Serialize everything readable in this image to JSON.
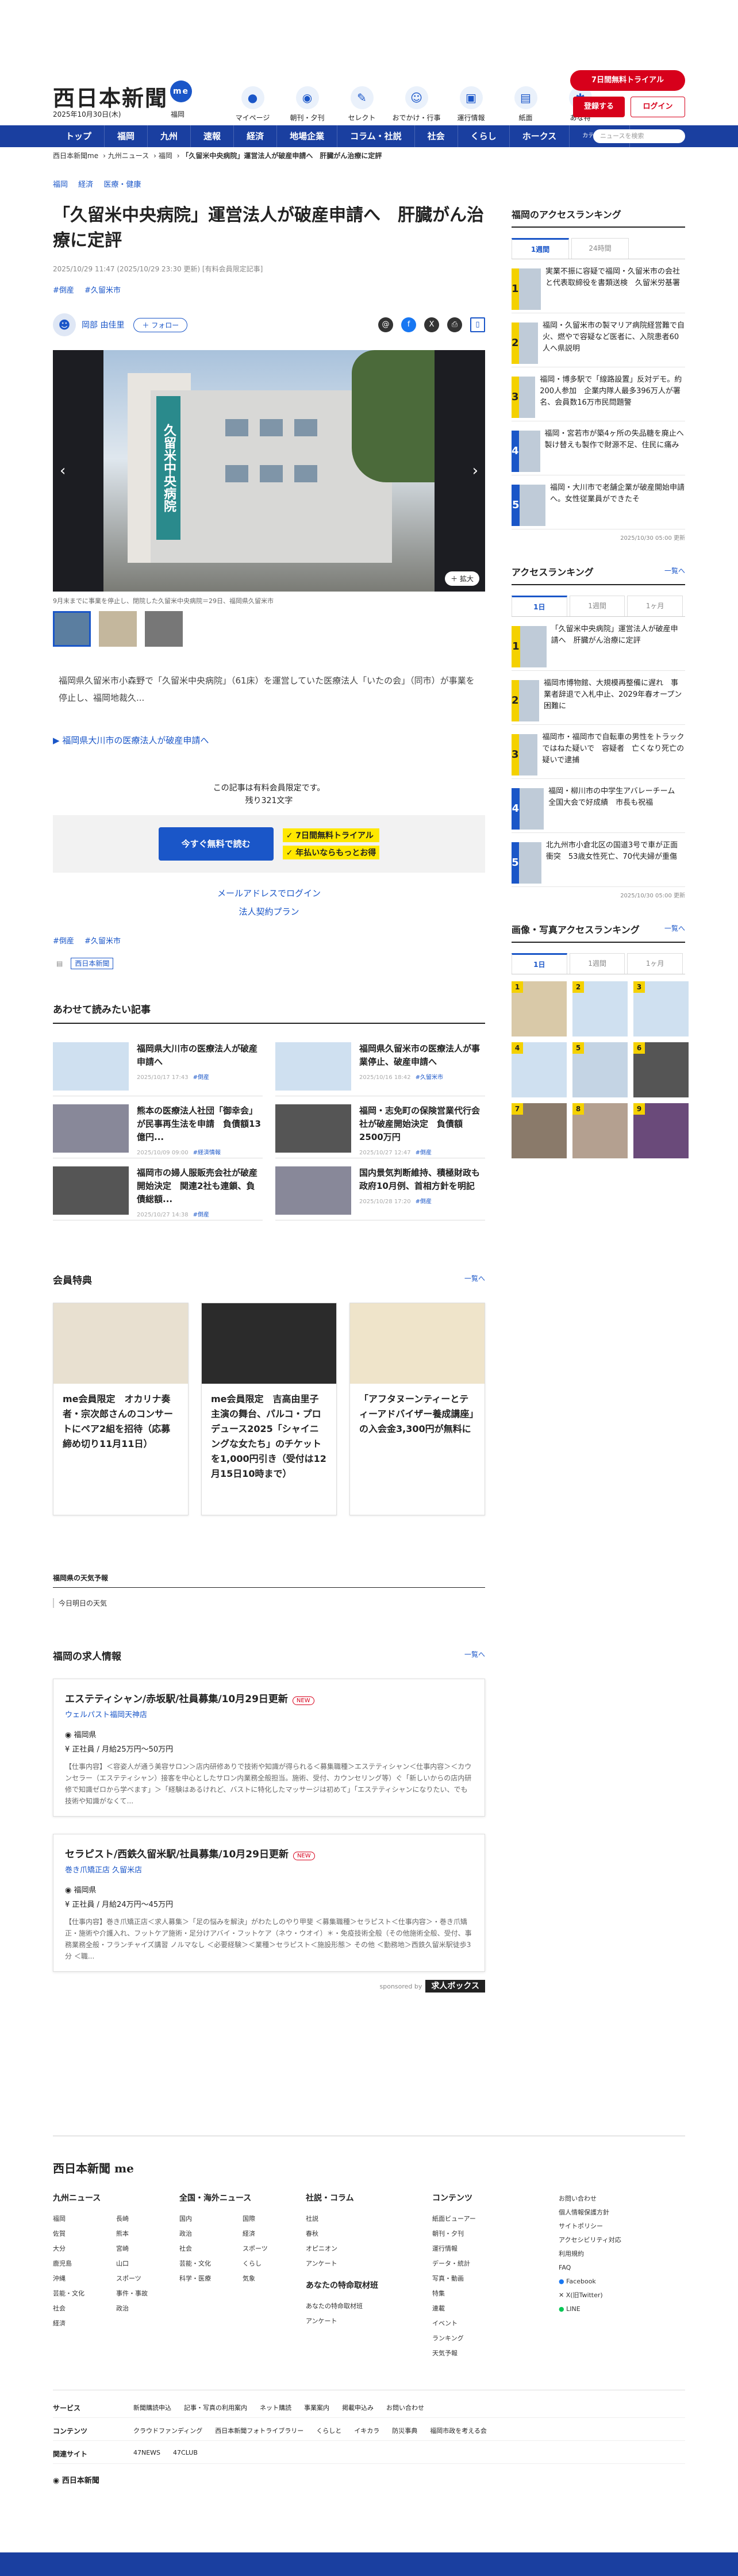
{
  "header": {
    "logo": "西日本新聞",
    "logo_badge": "me",
    "date": "2025年10月30日(木)",
    "region": "福岡",
    "icons": [
      {
        "label": "マイページ",
        "icon": "me-icon"
      },
      {
        "label": "朝刊・夕刊",
        "icon": "newspaper-icon"
      },
      {
        "label": "セレクト",
        "icon": "select-icon"
      },
      {
        "label": "おでかけ・行事",
        "icon": "outing-icon"
      },
      {
        "label": "運行情報",
        "icon": "train-icon"
      },
      {
        "label": "紙面",
        "icon": "paper-icon"
      },
      {
        "label": "あな特",
        "icon": "anatoku-icon"
      }
    ],
    "trial": "7日間無料トライアル",
    "register": "登録する",
    "login": "ログイン"
  },
  "nav": [
    "トップ",
    "福岡",
    "九州",
    "速報",
    "経済",
    "地場企業",
    "コラム・社説",
    "社会",
    "くらし",
    "ホークス",
    "カテゴリ一覧"
  ],
  "search_placeholder": "ニュースを検索",
  "breadcrumb": [
    "西日本新聞me",
    "九州ニュース",
    "福岡",
    "「久留米中央病院」運営法人が破産申請へ　肝臓がん治療に定評"
  ],
  "article": {
    "section_tags": [
      "福岡",
      "経済",
      "医療・健康"
    ],
    "title": "「久留米中央病院」運営法人が破産申請へ　肝臓がん治療に定評",
    "date": "2025/10/29 11:47 (2025/10/29 23:30 更新) [有料会員限定記事]",
    "tags": [
      "#倒産",
      "#久留米市"
    ],
    "author": "岡部 由佳里",
    "follow": "＋ フォロー",
    "photo_sign": "久留米中央病院",
    "zoom": "拡大",
    "caption": "9月末までに事業を停止し、閉院した久留米中央病院＝29日、福岡県久留米市",
    "lede": "福岡県久留米市小森野で「久留米中央病院」（61床）を運営していた医療法人「いたの会」（同市）が事業を停止し、福岡地裁久...",
    "related": "福岡県大川市の医療法人が破産申請へ",
    "pay_note": "この記事は有料会員限定です。",
    "pay_remain": "残り321文字",
    "pay_button": "今すぐ無料で読む",
    "pay_points": [
      "7日間無料トライアル",
      "年払いならもっとお得"
    ],
    "mail_login": "メールアドレスでログイン",
    "corp_plan": "法人契約プラン",
    "bottom_tags": [
      "#倒産",
      "#久留米市"
    ],
    "source": "西日本新聞"
  },
  "reads": {
    "title": "あわせて読みたい記事",
    "items": [
      {
        "title": "福岡県大川市の医療法人が破産申請へ",
        "meta": "2025/10/17 17:43",
        "tag": "#倒産"
      },
      {
        "title": "福岡県久留米市の医療法人が事業停止、破産申請へ",
        "meta": "2025/10/16 18:42",
        "tag": "#久留米市"
      },
      {
        "title": "熊本の医療法人社団「御幸会」が民事再生法を申請　負債額13億円...",
        "meta": "2025/10/09 09:00",
        "tag": "#経済情報"
      },
      {
        "title": "福岡・志免町の保険営業代行会社が破産開始決定　負債額2500万円",
        "meta": "2025/10/27 12:47",
        "tag": "#倒産"
      },
      {
        "title": "福岡市の婦人服販売会社が破産開始決定　関連2社も連鎖、負債総額...",
        "meta": "2025/10/27 14:38",
        "tag": "#倒産"
      },
      {
        "title": "国内景気判断維持、積極財政も　政府10月例、首相方針を明記",
        "meta": "2025/10/28 17:20",
        "tag": "#倒産"
      }
    ]
  },
  "benefits": {
    "title": "会員特典",
    "more": "一覧へ",
    "items": [
      "me会員限定　オカリナ奏者・宗次郎さんのコンサートにペア2組を招待（応募締め切り11月11日）",
      "me会員限定　吉高由里子主演の舞台、パルコ・プロデュース2025「シャイニングな女たち」のチケットを1,000円引き（受付は12月15日10時まで）",
      "「アフタヌーンティーとティーアドバイザー養成講座」の入会金3,300円が無料に"
    ]
  },
  "weather": {
    "title": "福岡県の天気予報",
    "sub": "今日明日の天気"
  },
  "jobs": {
    "title": "福岡の求人情報",
    "more": "一覧へ",
    "items": [
      {
        "title": "エステティシャン/赤坂駅/社員募集/10月29日更新",
        "new": "NEW",
        "company": "ウェルパスト福岡天神店",
        "location": "福岡県",
        "salary": "正社員 / 月給25万円〜50万円",
        "desc": "【仕事内容】＜容姿人が通う美容サロン＞店内研修ありで技術や知識が得られる＜募集職種＞エステティシャン＜仕事内容＞＜カウンセラー（エステティシャン）接客を中心としたサロン内業務全般担当。施術、受付、カウンセリング等）ぐ「新しいからの店内研修で知識ゼロから学べます」＞「経験はあるけれど、バストに特化したマッサージは初めて」「エステティシャンになりたい、でも技術や知識がなくて..."
      },
      {
        "title": "セラピスト/西鉄久留米駅/社員募集/10月29日更新",
        "new": "NEW",
        "company": "巻き爪矯正店 久留米店",
        "location": "福岡県",
        "salary": "正社員 / 月給24万円〜45万円",
        "desc": "【仕事内容】巻き爪矯正店＜求人募集＞「足の悩みを解決」がわたしのやり甲斐 ＜募集職種＞セラピスト＜仕事内容＞・巻き爪矯正・施術や介護入れ、フットケア施術・足分けアバイ・フットケア（ネウ・ウオイ）＊・免疫技術全般（その他施術全般、受付、事務業務全般・フランチャイズ講習 ノルマなし ＜必要経験＞＜業種＞セラピスト＜施設形態＞ その他 ＜勤務地＞西鉄久留米駅徒歩3分 ＜職..."
      }
    ],
    "sponsor": "sponsored by",
    "sponsor_name": "求人ボックス"
  },
  "sidebar": {
    "access_title": "福岡のアクセスランキング",
    "access_tabs": [
      "1週間",
      "24時間"
    ],
    "access": [
      "実業不振に容疑で福岡・久留米市の会社と代表取締役を書類送検　久留米労基署",
      "福岡・久留米市の製マリア病院経営難で自火、燃やで容疑など医者に、入院患者60人へ県説明",
      "福岡・博多駅で「線路設置」反対デモ。約200人参加　企業内隊人最多396万人が署名、会員数16万市民問題警",
      "福岡・宮若市が築4ヶ所の失品糖を廃止へ　製け替えも製作で財源不足、住民に痛み",
      "福岡・大川市で老舗企業が破産開始申請へ。女性従業員ができたそ"
    ],
    "access_stamp": "2025/10/30 05:00 更新",
    "access2_title": "アクセスランキング",
    "access2_more": "一覧へ",
    "access2_tabs": [
      "1日",
      "1週間",
      "1ヶ月"
    ],
    "access2": [
      "「久留米中央病院」運営法人が破産申請へ　肝臓がん治療に定評",
      "福岡市博物館、大規模再整備に遅れ　事業者辞退で入札中止、2029年春オープン困難に",
      "福岡市・福岡市で自転車の男性をトラックではねた疑いで　容疑者　亡くなり死亡の疑いで逮捕",
      "福岡・柳川市の中学生アバレーチーム　全国大会で好成績　市長も祝福",
      "北九州市小倉北区の国道3号で車が正面衝突　53歳女性死亡、70代夫婦が重傷"
    ],
    "access2_stamp": "2025/10/30 05:00 更新",
    "photo_title": "画像・写真アクセスランキング",
    "photo_more": "一覧へ",
    "photo_tabs": [
      "1日",
      "1週間",
      "1ヶ月"
    ]
  },
  "footer": {
    "logo": "西日本新聞 me",
    "cols": [
      {
        "title": "九州ニュース",
        "items": [
          "福岡",
          "長崎",
          "佐賀",
          "熊本",
          "大分",
          "宮崎",
          "鹿児島",
          "山口",
          "沖縄",
          "スポーツ",
          "芸能・文化",
          "事件・事故",
          "社会",
          "政治",
          "経済"
        ]
      },
      {
        "title": "全国・海外ニュース",
        "items": [
          "国内",
          "国際",
          "政治",
          "経済",
          "社会",
          "スポーツ",
          "芸能・文化",
          "くらし",
          "科学・医療",
          "気象"
        ]
      },
      {
        "title": "社説・コラム",
        "items": [
          "社説",
          "春秋",
          "オピニオン",
          "アンケート"
        ]
      },
      {
        "title": "コンテンツ",
        "items": [
          "紙面ビューアー",
          "朝刊・夕刊",
          "運行情報",
          "データ・統計",
          "写真・動画",
          "特集",
          "連載",
          "イベント",
          "ランキング",
          "天気予報"
        ]
      }
    ],
    "extra_title": "あなたの特命取材班",
    "extra": [
      "あなたの特命取材班",
      "アンケート"
    ],
    "side": [
      "お問い合わせ",
      "個人情報保護方針",
      "サイトポリシー",
      "アクセシビリティ対応",
      "利用規約",
      "FAQ",
      "Facebook",
      "X(旧Twitter)",
      "LINE"
    ],
    "rows": [
      {
        "label": "サービス",
        "items": [
          "新聞購読申込",
          "記事・写真の利用案内",
          "ネット購読",
          "事業案内",
          "掲載申込み",
          "お問い合わせ"
        ]
      },
      {
        "label": "コンテンツ",
        "items": [
          "クラウドファンディング",
          "西日本新聞フォトライブラリー",
          "くらしと",
          "イキカラ",
          "防災事典",
          "福岡市政を考える会"
        ]
      },
      {
        "label": "関連サイト",
        "items": [
          "47NEWS",
          "47CLUB"
        ]
      }
    ],
    "company": "西日本新聞"
  }
}
